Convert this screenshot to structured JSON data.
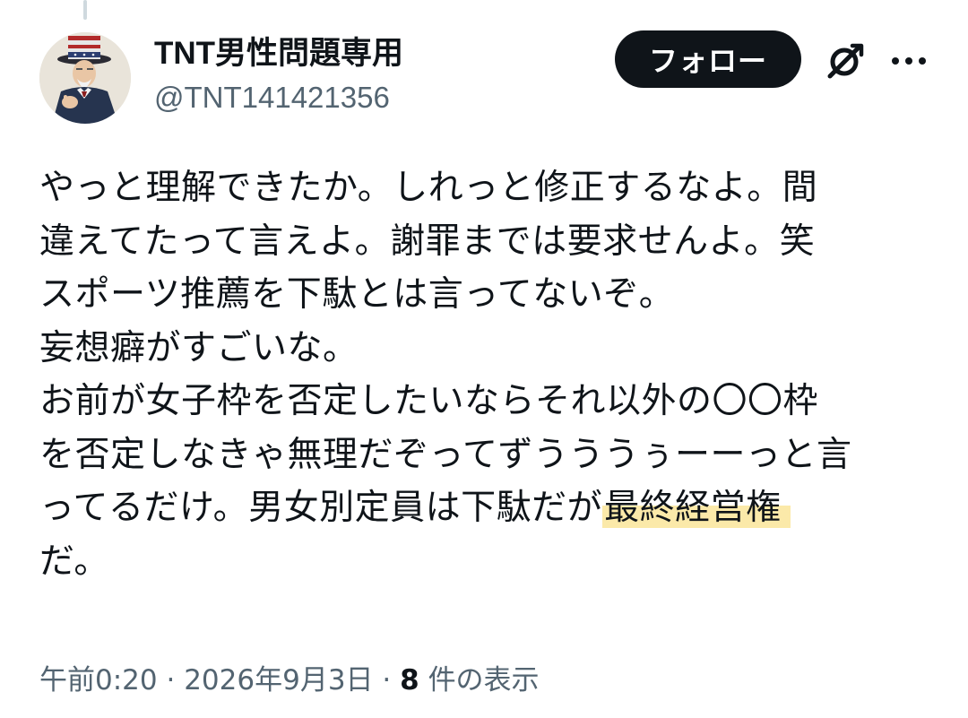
{
  "author": {
    "display_name": "TNT男性問題専用",
    "handle": "@TNT141421356"
  },
  "actions": {
    "follow_label": "フォロー",
    "grok_icon": "grok-slash-icon",
    "more_icon": "more-horizontal-icon"
  },
  "post": {
    "lines": [
      "やっと理解できたか。しれっと修正するなよ。間",
      "違えてたって言えよ。謝罪までは要求せんよ。笑",
      "スポーツ推薦を下駄とは言ってないぞ。",
      "妄想癖がすごいな。",
      "お前が女子枠を否定したいならそれ以外の〇〇枠",
      "を否定しなきゃ無理だぞってずうううぅーーっと言",
      "ってるだけ。男女別定員は下駄だが",
      "だ。"
    ],
    "highlighted_text": "最終経営権",
    "highlight_color": "#fae28c"
  },
  "meta": {
    "time": "午前0:20",
    "separator": "·",
    "date": "2026年9月3日",
    "views_count": "8",
    "views_label": "件の表示"
  }
}
